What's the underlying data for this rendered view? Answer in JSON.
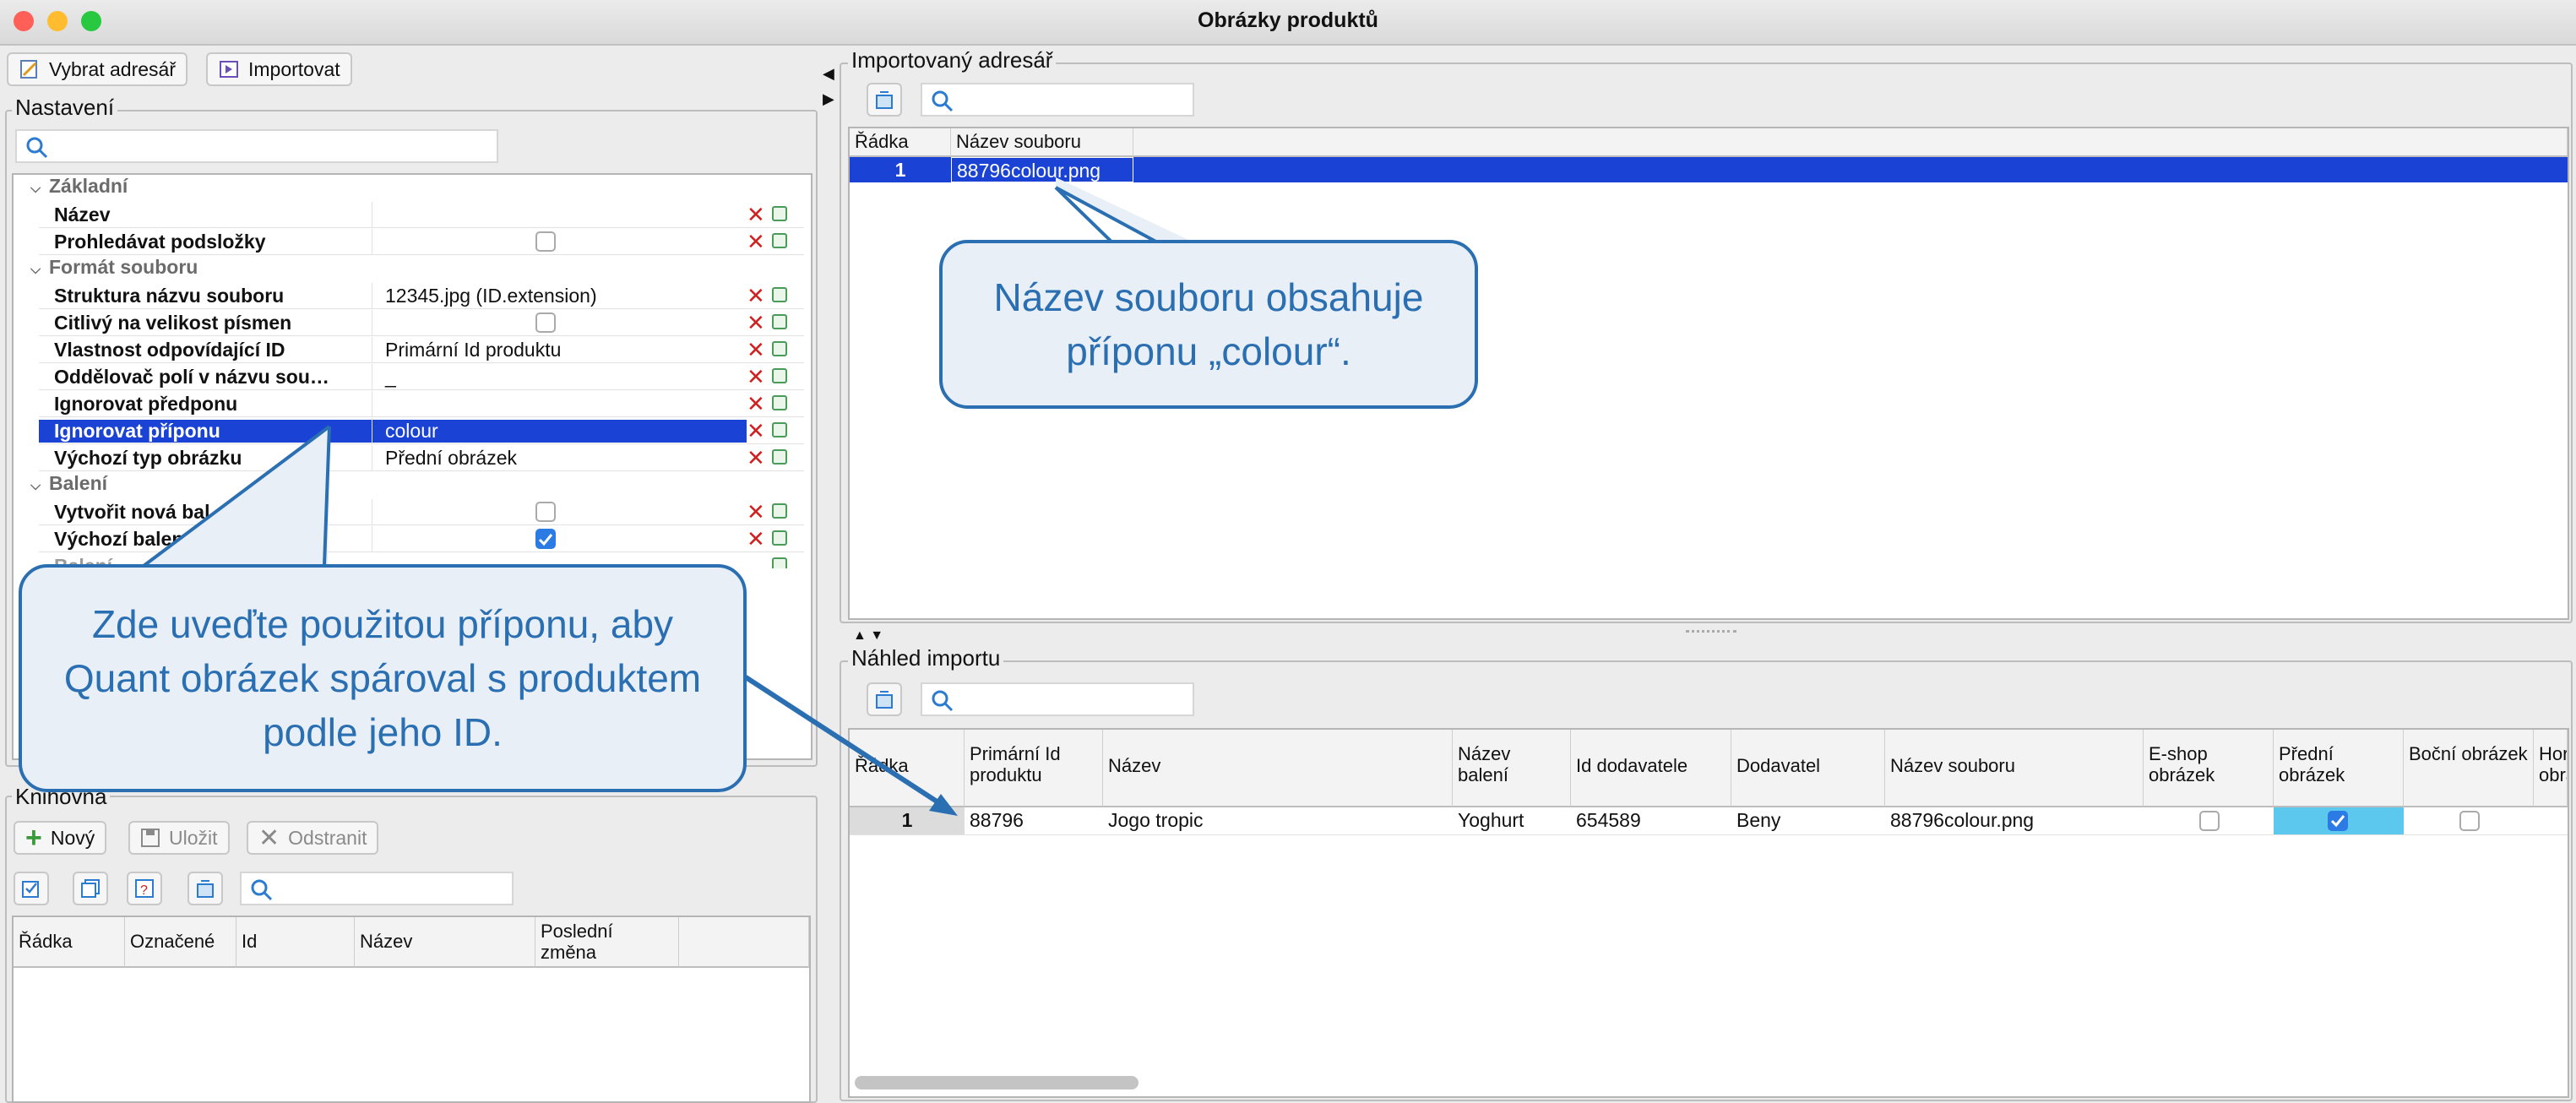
{
  "window": {
    "title": "Obrázky produktů"
  },
  "toolbar": {
    "select_dir": "Vybrat adresář",
    "import": "Importovat"
  },
  "settings": {
    "title": "Nastavení",
    "categories": {
      "basic": "Základní",
      "file_format": "Formát souboru",
      "packing": "Balení",
      "packing_cut": "Balení"
    },
    "rows": {
      "name": {
        "label": "Název",
        "value": ""
      },
      "subfolders": {
        "label": "Prohledávat podsložky"
      },
      "structure": {
        "label": "Struktura názvu souboru",
        "value": "12345.jpg (ID.extension)"
      },
      "case": {
        "label": "Citlivý na velikost písmen"
      },
      "id_prop": {
        "label": "Vlastnost odpovídající ID",
        "value": "Primární Id produktu"
      },
      "separator": {
        "label": "Oddělovač polí v názvu sou…",
        "value": "_"
      },
      "ignore_prefix": {
        "label": "Ignorovat předponu",
        "value": ""
      },
      "ignore_suffix": {
        "label": "Ignorovat příponu",
        "value": "colour"
      },
      "default_type": {
        "label": "Výchozí typ obrázku",
        "value": "Přední obrázek"
      },
      "create_pack": {
        "label": "Vytvořit nová bal"
      },
      "default_pack": {
        "label": "Výchozí balen"
      }
    }
  },
  "library": {
    "title": "Knihovna",
    "new": "Nový",
    "save": "Uložit",
    "remove": "Odstranit",
    "columns": [
      "Řádka",
      "Označené",
      "Id",
      "Název",
      "Poslední změna"
    ]
  },
  "imported_dir": {
    "title": "Importovaný adresář",
    "columns": [
      "Řádka",
      "Název souboru"
    ],
    "rows": [
      {
        "row": "1",
        "file": "88796colour.png"
      }
    ]
  },
  "preview": {
    "title": "Náhled importu",
    "columns": [
      "Řádka",
      "Primární Id produktu",
      "Název",
      "Název balení",
      "Id dodavatele",
      "Dodavatel",
      "Název souboru",
      "E-shop obrázek",
      "Přední obrázek",
      "Boční obrázek",
      "Hor obrá"
    ],
    "rows": [
      {
        "row": "1",
        "id": "88796",
        "name": "Jogo tropic",
        "pack": "Yoghurt",
        "supplier_id": "654589",
        "supplier": "Beny",
        "file": "88796colour.png",
        "eshop": false,
        "front": true,
        "side": false
      }
    ]
  },
  "callouts": {
    "top": "Název souboru obsahuje příponu „colour“.",
    "left": "Zde uveďte použitou příponu, aby Quant obrázek spároval s produktem podle jeho ID."
  },
  "colors": {
    "selection": "#1a43d6",
    "callout_border": "#2b6fb3",
    "callout_fill": "#e9eff6",
    "front_cell": "#5cc8ee"
  }
}
